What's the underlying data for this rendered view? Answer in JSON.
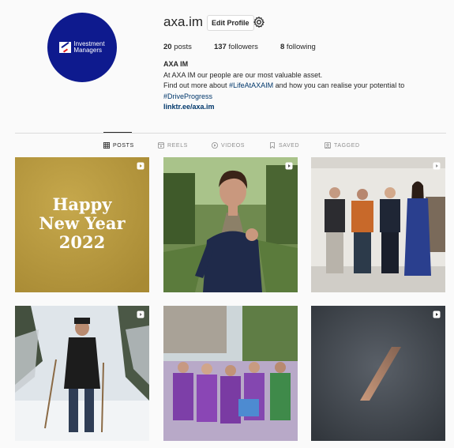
{
  "profile": {
    "username": "axa.im",
    "edit_label": "Edit Profile",
    "avatar_logo_text_line1": "Investment",
    "avatar_logo_text_line2": "Managers",
    "stats": {
      "posts_count": "20",
      "posts_label": "posts",
      "followers_count": "137",
      "followers_label": "followers",
      "following_count": "8",
      "following_label": "following"
    },
    "bio": {
      "name": "AXA IM",
      "line1": "At AXA IM our people are our most valuable asset.",
      "line2_prefix": "Find out more about ",
      "hashtag1": "#LifeAtAXAIM",
      "line2_suffix": " and how you can realise your potential to",
      "hashtag2": "#DriveProgress",
      "link": "linktr.ee/axa.im"
    }
  },
  "tabs": [
    {
      "label": "POSTS",
      "icon": "grid-icon",
      "active": true
    },
    {
      "label": "REELS",
      "icon": "reels-icon",
      "active": false
    },
    {
      "label": "VIDEOS",
      "icon": "video-icon",
      "active": false
    },
    {
      "label": "SAVED",
      "icon": "bookmark-icon",
      "active": false
    },
    {
      "label": "TAGGED",
      "icon": "tag-icon",
      "active": false
    }
  ],
  "posts": {
    "p1": {
      "line1": "Happy",
      "line2": "New Year",
      "line3": "2022",
      "bg": "#b89a3e"
    },
    "p2": {
      "description": "woman running in park"
    },
    "p3": {
      "description": "four people in gallery"
    },
    "p4": {
      "description": "person hiking in snow"
    },
    "p5": {
      "description": "group in purple vests"
    },
    "p6": {
      "description": "dark abstract with logo stroke"
    }
  },
  "colors": {
    "brand_navy": "#0e1a8e",
    "link_blue": "#00376b",
    "text": "#262626",
    "muted": "#8e8e8e"
  }
}
